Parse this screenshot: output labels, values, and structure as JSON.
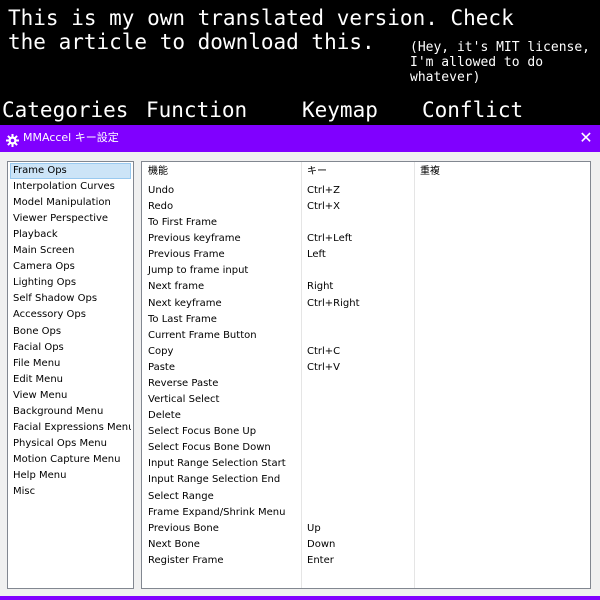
{
  "banner": {
    "main_text": "This is my own translated version. Check the article to download this.",
    "note_text": "(Hey, it's MIT license, I'm allowed to do whatever)",
    "headers": [
      "Categories",
      "Function",
      "Keymap",
      "Conflict"
    ]
  },
  "window": {
    "title": "MMAccel キー設定",
    "app_icon": "gear-icon",
    "close_label": "✕",
    "accent_color": "#8000ff"
  },
  "columns": [
    "機能",
    "キー",
    "重複"
  ],
  "categories": [
    "Frame Ops",
    "Interpolation Curves",
    "Model Manipulation",
    "Viewer Perspective",
    "Playback",
    "Main Screen",
    "Camera Ops",
    "Lighting Ops",
    "Self Shadow Ops",
    "Accessory Ops",
    "Bone Ops",
    "Facial Ops",
    "File Menu",
    "Edit Menu",
    "View Menu",
    "Background Menu",
    "Facial Expressions Menu",
    "Physical Ops Menu",
    "Motion Capture Menu",
    "Help Menu",
    "Misc"
  ],
  "selected_category": "Frame Ops",
  "rows": [
    {
      "function": "Undo",
      "key": "Ctrl+Z",
      "conflict": ""
    },
    {
      "function": "Redo",
      "key": "Ctrl+X",
      "conflict": ""
    },
    {
      "function": "To First Frame",
      "key": "",
      "conflict": ""
    },
    {
      "function": "Previous keyframe",
      "key": "Ctrl+Left",
      "conflict": ""
    },
    {
      "function": "Previous Frame",
      "key": "Left",
      "conflict": ""
    },
    {
      "function": "Jump to frame input",
      "key": "",
      "conflict": ""
    },
    {
      "function": "Next frame",
      "key": "Right",
      "conflict": ""
    },
    {
      "function": "Next keyframe",
      "key": "Ctrl+Right",
      "conflict": ""
    },
    {
      "function": "To Last Frame",
      "key": "",
      "conflict": ""
    },
    {
      "function": "Current Frame Button",
      "key": "",
      "conflict": ""
    },
    {
      "function": "Copy",
      "key": "Ctrl+C",
      "conflict": ""
    },
    {
      "function": "Paste",
      "key": "Ctrl+V",
      "conflict": ""
    },
    {
      "function": "Reverse Paste",
      "key": "",
      "conflict": ""
    },
    {
      "function": "Vertical Select",
      "key": "",
      "conflict": ""
    },
    {
      "function": "Delete",
      "key": "",
      "conflict": ""
    },
    {
      "function": "Select Focus Bone Up",
      "key": "",
      "conflict": ""
    },
    {
      "function": "Select Focus Bone Down",
      "key": "",
      "conflict": ""
    },
    {
      "function": "Input Range Selection Start",
      "key": "",
      "conflict": ""
    },
    {
      "function": "Input Range Selection End",
      "key": "",
      "conflict": ""
    },
    {
      "function": "Select Range",
      "key": "",
      "conflict": ""
    },
    {
      "function": "Frame Expand/Shrink Menu",
      "key": "",
      "conflict": ""
    },
    {
      "function": "Previous Bone",
      "key": "Up",
      "conflict": ""
    },
    {
      "function": "Next Bone",
      "key": "Down",
      "conflict": ""
    },
    {
      "function": "Register Frame",
      "key": "Enter",
      "conflict": ""
    }
  ]
}
